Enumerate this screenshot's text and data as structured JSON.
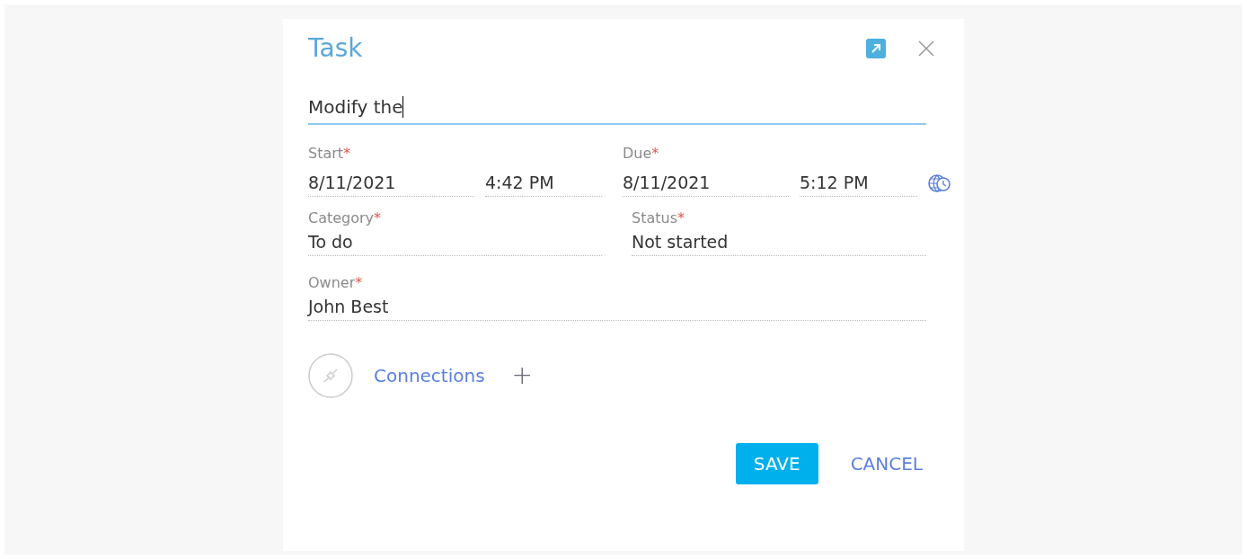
{
  "dialog": {
    "title": "Task",
    "subject": {
      "value": "Modify the"
    },
    "dates": [
      {
        "label": "Start",
        "mark": "*",
        "date": "8/11/2021",
        "time": "4:42 PM"
      },
      {
        "label": "Due",
        "mark": "*",
        "date": "8/11/2021",
        "time": "5:12 PM"
      }
    ],
    "lookups": [
      {
        "label": "Category",
        "mark": "*",
        "value": "To do"
      },
      {
        "label": "Status",
        "mark": "*",
        "value": "Not started"
      },
      {
        "label": "Owner",
        "mark": "*",
        "value": "John Best"
      }
    ],
    "connections": {
      "label": "Connections",
      "add": "+"
    },
    "buttons": [
      {
        "kind": "primary",
        "label": "SAVE"
      },
      {
        "kind": "link",
        "label": "CANCEL"
      }
    ]
  }
}
